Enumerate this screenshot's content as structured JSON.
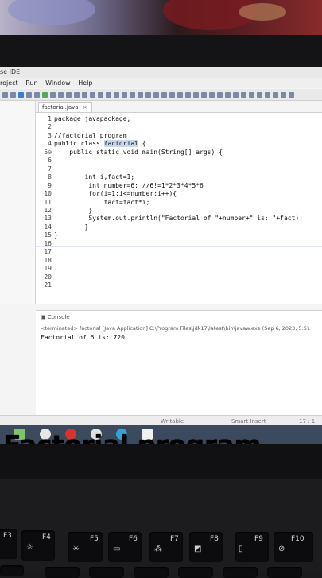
{
  "ide": {
    "title": "se IDE",
    "menu": [
      "roject",
      "Run",
      "Window",
      "Help"
    ],
    "tab_label": "factorial.java",
    "line_numbers": [
      "1",
      "2",
      "3",
      "4",
      "5⊖",
      "6",
      "7",
      "8",
      "9",
      "10",
      "11",
      "12",
      "13",
      "14",
      "15",
      "16",
      "17",
      "18",
      "19",
      "20",
      "21"
    ],
    "code_lines": [
      "package javapackage;",
      "",
      "//factorial program",
      "public class factorial {",
      "    public static void main(String[] args) {",
      "",
      "",
      "        int i,fact=1;",
      "         int number=6; //6!=1*2*3*4*5*6",
      "         for(i=1;i<=number;i++){",
      "             fact=fact*i;",
      "         }",
      "         System.out.println(\"Factorial of \"+number+\" is: \"+fact);",
      "        }",
      "}",
      "",
      "",
      "",
      "",
      "",
      ""
    ],
    "console_tab": "Console",
    "console_terminated": "<terminated> factorial [Java Application] C:\\Program Files\\jdk17\\latest\\bin\\javaw.exe  (Sep 6, 2023, 5:51",
    "console_output": "Factorial of 6 is: 720",
    "status": {
      "writable": "Writable",
      "insert": "Smart Insert",
      "position": "17 : 1"
    }
  },
  "caption": "Factorial program",
  "keyboard": {
    "keys": [
      "F3",
      "F4",
      "F5",
      "F6",
      "F7",
      "F8",
      "F9",
      "F10"
    ]
  },
  "colors": {
    "caption": "#000000",
    "taskbar": "#3c4a5e",
    "editor_bg": "#ffffff"
  }
}
